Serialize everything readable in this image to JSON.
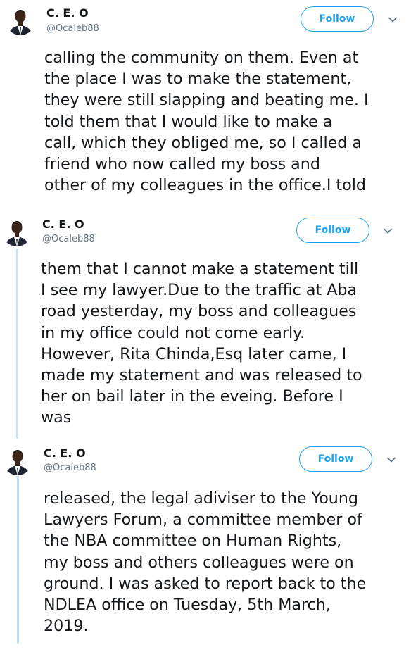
{
  "colors": {
    "accent": "#1da1f2",
    "thread_line": "#c4e3f8",
    "text": "#14171a",
    "secondary": "#657786"
  },
  "tweets": [
    {
      "name": "C. E. O",
      "handle": "@Ocaleb88",
      "follow_label": "Follow",
      "menu_icon": "chevron-down-icon",
      "lines": [
        "calling the community on them. Even at",
        "the place I was to make the statement,",
        "they were still slapping and beating me. I",
        "told them that I would like to make a",
        "call, which they obliged me, so I called a",
        "friend who now called my boss and",
        "other of my colleagues in the office.I told"
      ]
    },
    {
      "name": "C. E. O",
      "handle": "@Ocaleb88",
      "follow_label": "Follow",
      "menu_icon": "chevron-down-icon",
      "lines": [
        "them that I cannot make a statement till",
        "I see my lawyer.Due to the traffic at Aba",
        "road yesterday, my boss and colleagues",
        "in my office could not come early.",
        "However, Rita Chinda,Esq later came, I",
        "made my statement and was released to",
        "her on bail later in the eveing. Before I",
        "was"
      ]
    },
    {
      "name": "C. E. O",
      "handle": "@Ocaleb88",
      "follow_label": "Follow",
      "menu_icon": "chevron-down-icon",
      "lines": [
        "released, the legal adiviser to the Young",
        "Lawyers Forum, a committee member of",
        "the NBA committee on Human Rights,",
        "my boss and others colleagues were on",
        "ground. I was asked to report back to the",
        "NDLEA office on Tuesday, 5th March,",
        "2019."
      ]
    }
  ]
}
